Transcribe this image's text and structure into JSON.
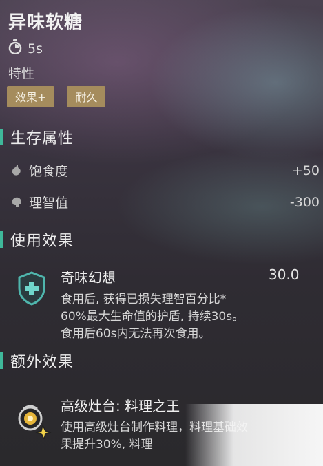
{
  "item": {
    "title": "异味软糖",
    "duration": "5s"
  },
  "traits": {
    "label": "特性",
    "tags": [
      "效果+",
      "耐久"
    ]
  },
  "survival": {
    "title": "生存属性",
    "rows": [
      {
        "label": "饱食度",
        "value": "+50",
        "icon": "stomach-icon"
      },
      {
        "label": "理智值",
        "value": "-300",
        "icon": "brain-icon"
      }
    ]
  },
  "use_effect": {
    "title": "使用效果",
    "name": "奇味幻想",
    "value": "30.0",
    "icon": "shield-cross-icon",
    "desc": [
      "食用后, 获得已损失理智百分比*",
      "60%最大生命值的护盾, 持续30s。",
      "食用后60s内无法再次食用。"
    ]
  },
  "extra_effect": {
    "title": "额外效果",
    "name": "高级灶台: 料理之王",
    "icon": "cooking-pot-icon",
    "desc": [
      "使用高级灶台制作料理，料理基础效",
      "果提升30%, 料理"
    ]
  },
  "colors": {
    "accent": "#3fb89a",
    "tag_bg": "#a58c5d"
  }
}
